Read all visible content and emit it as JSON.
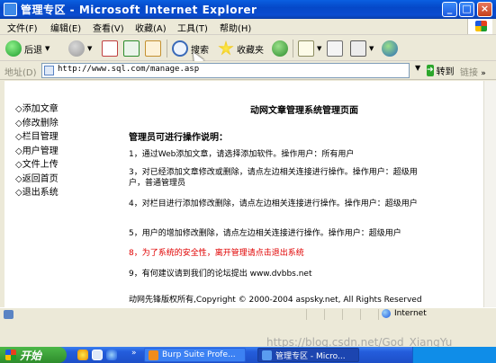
{
  "window": {
    "title": "管理专区 - Microsoft Internet Explorer",
    "min_label": "_",
    "max_label": "□",
    "close_label": "×"
  },
  "menu": {
    "items": [
      {
        "label": "文件(F)"
      },
      {
        "label": "编辑(E)"
      },
      {
        "label": "查看(V)"
      },
      {
        "label": "收藏(A)"
      },
      {
        "label": "工具(T)"
      },
      {
        "label": "帮助(H)"
      }
    ]
  },
  "toolbar": {
    "back_label": "后退",
    "search_label": "搜索",
    "favorites_label": "收藏夹"
  },
  "address": {
    "label": "地址(D)",
    "url": "http://www.sql.com/manage.asp",
    "go_label": "转到",
    "links_label": "链接",
    "links_chevron": "»"
  },
  "sidebar": {
    "items": [
      {
        "label": "◇添加文章"
      },
      {
        "label": "◇修改删除"
      },
      {
        "label": "◇栏目管理"
      },
      {
        "label": "◇用户管理"
      },
      {
        "label": "◇文件上传"
      },
      {
        "label": "◇返回首页"
      },
      {
        "label": "◇退出系统"
      }
    ]
  },
  "main": {
    "title": "动网文章管理系统管理页面",
    "section_heading": "管理员可进行操作说明：",
    "paragraphs": [
      "1，通过Web添加文章，请选择添加软件。操作用户：所有用户",
      "3，对已经添加文章修改或删除，请点左边相关连接进行操作。操作用户：超级用户，普通管理员",
      "4，对栏目进行添加修改删除，请点左边相关连接进行操作。操作用户：超级用户",
      "5，用户的增加修改删除，请点左边相关连接进行操作。操作用户：超级用户",
      "8，为了系统的安全性，离开管理请点击退出系统",
      "9，有何建议请到我们的论坛提出 www.dvbbs.net"
    ],
    "copyright": "动网先锋版权所有,Copyright © 2000-2004 aspsky.net, All Rights Reserved"
  },
  "status": {
    "zone": "Internet"
  },
  "taskbar": {
    "start_label": "开始",
    "chevron": "»",
    "tasks": [
      {
        "label": "Burp Suite Profe..."
      },
      {
        "label": "管理专区 - Micro..."
      }
    ]
  },
  "watermark": "https://blog.csdn.net/God_XiangYu",
  "colors": {
    "titlebar": "#0548c8",
    "warning_text": "#e00000",
    "start_button": "#2e8c2c",
    "taskbar": "#245ddc"
  }
}
